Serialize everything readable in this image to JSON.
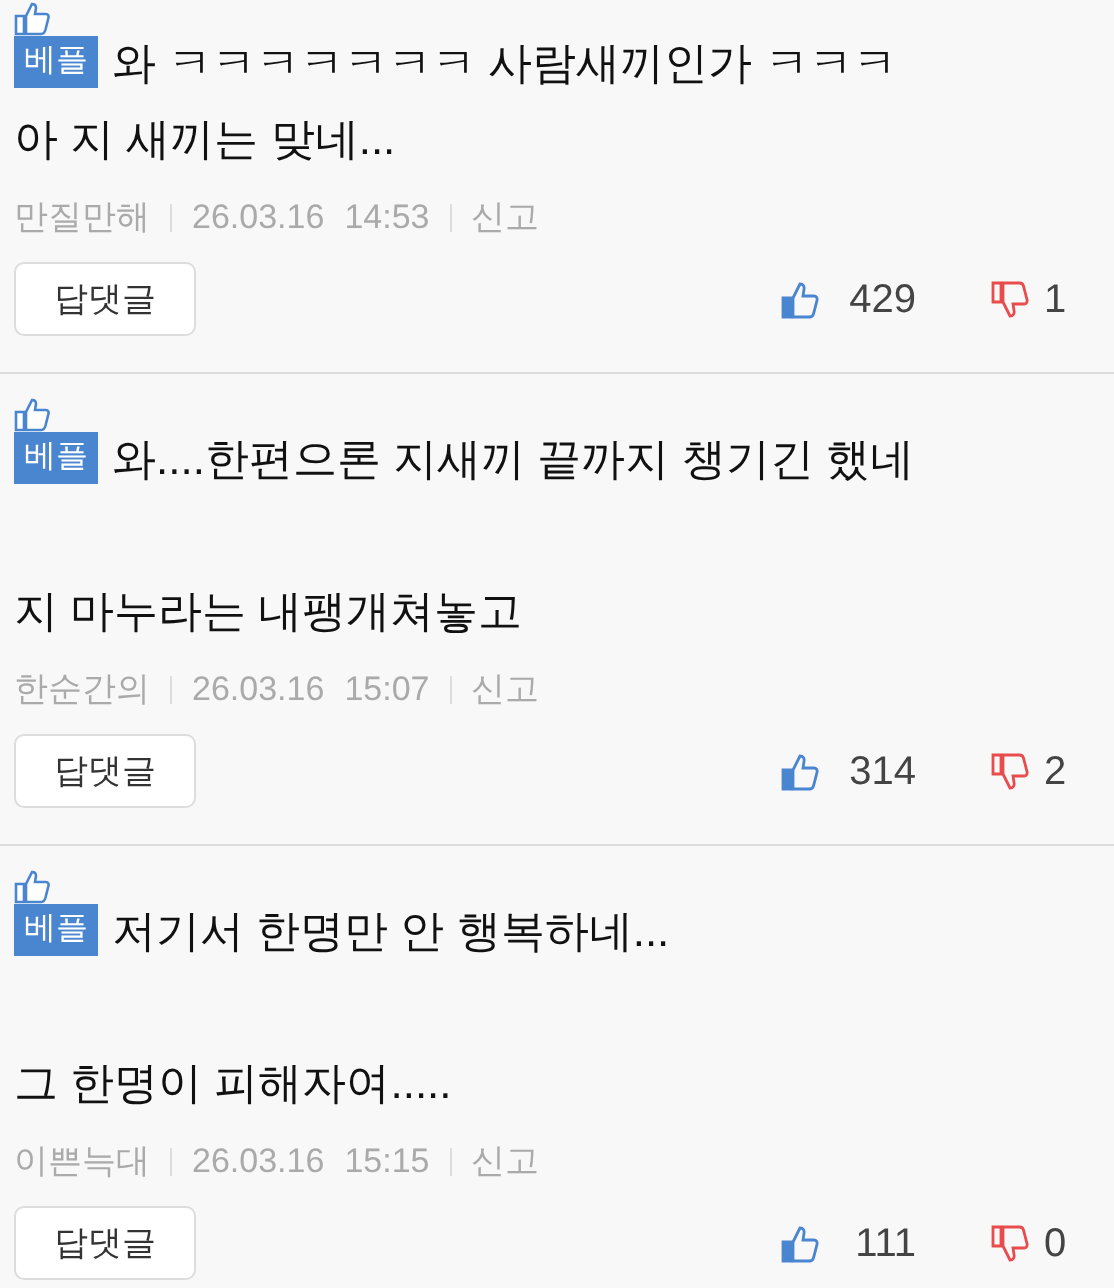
{
  "comments": [
    {
      "badge": "베플",
      "paragraphs": [
        [
          "와 ㅋㅋㅋㅋㅋㅋㅋ 사람새끼인가 ㅋㅋㅋ",
          "아 지 새끼는 맞네..."
        ]
      ],
      "author": "만질만해",
      "date": "26.03.16",
      "time": "14:53",
      "report": "신고",
      "reply_button": "답댓글",
      "likes": "429",
      "dislikes": "1"
    },
    {
      "badge": "베플",
      "paragraphs": [
        [
          "와....한편으론 지새끼 끝까지 챙기긴 했네"
        ],
        [
          "지 마누라는 내팽개쳐놓고"
        ]
      ],
      "author": "한순간의",
      "date": "26.03.16",
      "time": "15:07",
      "report": "신고",
      "reply_button": "답댓글",
      "likes": "314",
      "dislikes": "2"
    },
    {
      "badge": "베플",
      "paragraphs": [
        [
          "저기서 한명만 안 행복하네..."
        ],
        [
          "그 한명이 피해자여....."
        ]
      ],
      "author": "이쁜늑대",
      "date": "26.03.16",
      "time": "15:15",
      "report": "신고",
      "reply_button": "답댓글",
      "likes": "111",
      "dislikes": "0"
    }
  ]
}
